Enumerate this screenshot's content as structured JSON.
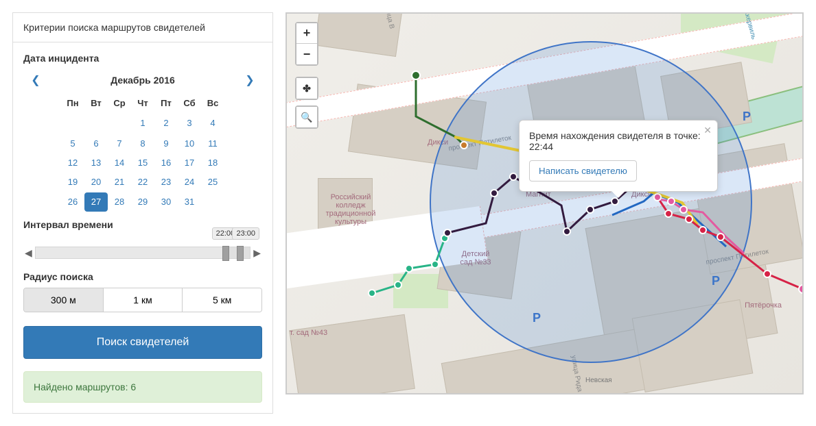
{
  "panel_title": "Критерии поиска маршрутов свидетелей",
  "labels": {
    "date": "Дата инцидента",
    "interval": "Интервал времени",
    "radius": "Радиус поиска"
  },
  "calendar": {
    "month": "Декабрь 2016",
    "dow": [
      "Пн",
      "Вт",
      "Ср",
      "Чт",
      "Пт",
      "Сб",
      "Вс"
    ],
    "selected": 27,
    "first_weekday": 3
  },
  "interval": {
    "from": "22:00",
    "to": "23:00"
  },
  "radius": {
    "options": [
      "300 м",
      "1 км",
      "5 км"
    ],
    "selected": 0
  },
  "search_button": "Поиск свидетелей",
  "result": "Найдено маршрутов: 6",
  "popup": {
    "text": "Время нахождения свидетеля в точке: 22:44",
    "button": "Написать свидетелю"
  },
  "map_labels": {
    "college": "Российский колледж традиционной культуры",
    "kindergarten": "Детский сад №33",
    "sad43": "т. сад №43",
    "diksi1": "Дикси",
    "diksi2": "Дикси",
    "magnit": "Магнит",
    "pyat": "Пятёрочка",
    "nevskaya": "Невская",
    "prospekt": "проспект Пятилеток",
    "prospekt2": "проспект Пятилеток",
    "okk": "Оккервиль",
    "rida": "улица Рида",
    "ulb": "Улица В"
  }
}
